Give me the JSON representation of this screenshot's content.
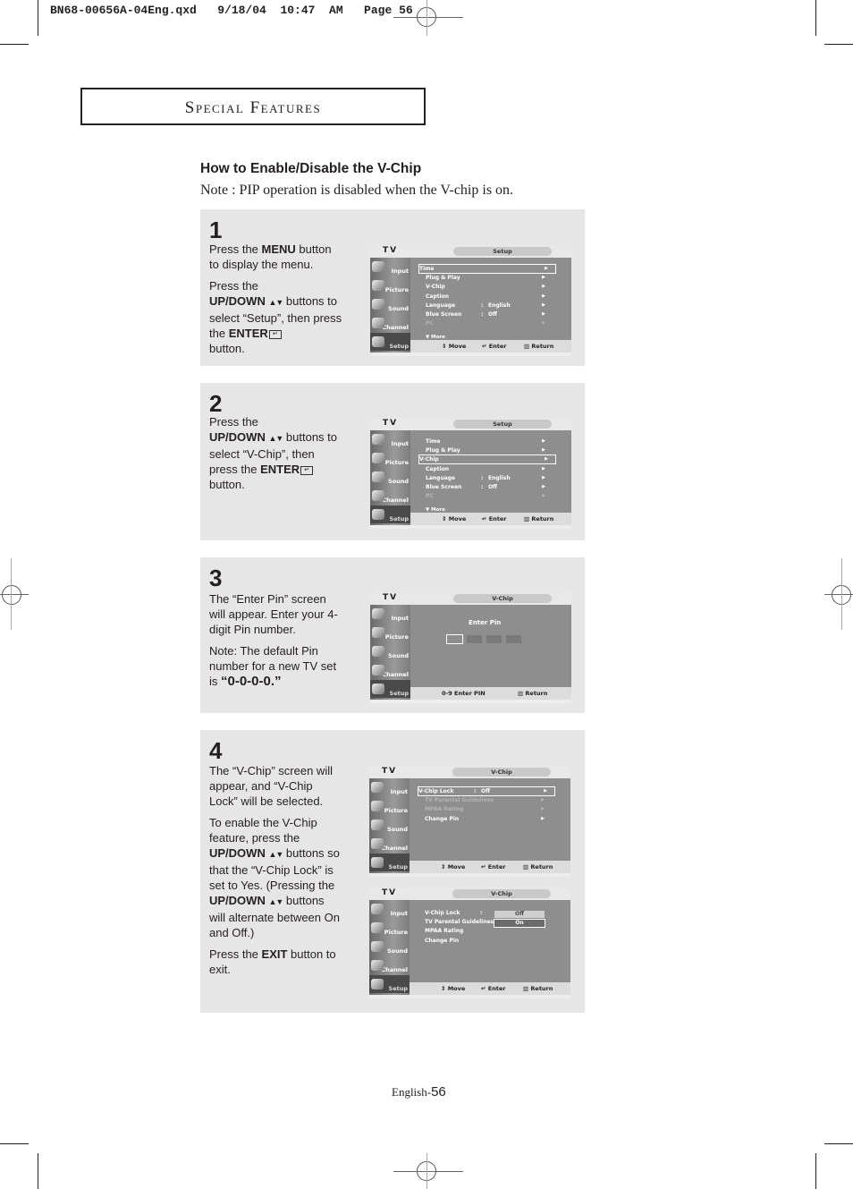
{
  "print_slug": "BN68-00656A-04Eng.qxd   9/18/04  10:47  AM   Page 56",
  "section_title": "Special Features",
  "heading": "How to Enable/Disable the V-Chip",
  "note": "Note : PIP operation is disabled when the V-chip is on.",
  "osd_common": {
    "tv_label": "TV",
    "sidebar": [
      "Input",
      "Picture",
      "Sound",
      "Channel",
      "Setup"
    ],
    "bottom": {
      "move": "Move",
      "enter": "Enter",
      "return": "Return"
    },
    "arrow": "▶",
    "updown_glyph": "▲▼"
  },
  "steps": [
    {
      "number": "1",
      "p1_a": "Press the ",
      "p1_b": "MENU",
      "p1_c": " button to display the menu.",
      "p2_a": "Press the ",
      "p2_b": "UP/DOWN",
      "p2_c": " buttons to select “Setup”, then press the ",
      "p2_d": "ENTER",
      "p2_e": " button.",
      "osd": {
        "title": "Setup",
        "rows": [
          {
            "label": "Time",
            "state": "selected"
          },
          {
            "label": "Plug & Play"
          },
          {
            "label": "V-Chip"
          },
          {
            "label": "Caption"
          },
          {
            "label": "Language",
            "value": "English"
          },
          {
            "label": "Blue Screen",
            "value": "Off"
          },
          {
            "label": "PC",
            "state": "dim"
          }
        ],
        "more": "▼ More"
      }
    },
    {
      "number": "2",
      "p1_a": "Press the ",
      "p1_b": "UP/DOWN",
      "p1_c": " buttons to select “V-Chip”, then press the ",
      "p1_d": "ENTER",
      "p1_e": " button.",
      "osd": {
        "title": "Setup",
        "rows": [
          {
            "label": "Time"
          },
          {
            "label": "Plug & Play"
          },
          {
            "label": "V-Chip",
            "state": "selected"
          },
          {
            "label": "Caption"
          },
          {
            "label": "Language",
            "value": "English"
          },
          {
            "label": "Blue Screen",
            "value": "Off"
          },
          {
            "label": "PC",
            "state": "dim"
          }
        ],
        "more": "▼ More"
      }
    },
    {
      "number": "3",
      "p1": "The “Enter Pin” screen will appear. Enter your 4-digit Pin number.",
      "p2_a": "Note: The default Pin number for a new TV set is ",
      "p2_b": "“0-0-0-0.”",
      "osd": {
        "title": "V-Chip",
        "prompt": "Enter Pin",
        "pin_digits": 4,
        "bottom_hint": "0-9 Enter PIN",
        "return": "Return"
      }
    },
    {
      "number": "4",
      "p1": "The “V-Chip” screen will appear, and “V-Chip Lock” will be selected.",
      "p2_a": "To enable the V-Chip feature, press the ",
      "p2_b": "UP/DOWN",
      "p2_c": " buttons so that the “V-Chip Lock” is set to Yes. (Pressing the ",
      "p2_d": "UP/DOWN",
      "p2_e": " buttons will alternate between On and Off.)",
      "p3_a": "Press the ",
      "p3_b": "EXIT",
      "p3_c": " button to exit.",
      "osd_a": {
        "title": "V-Chip",
        "rows": [
          {
            "label": "V-Chip Lock",
            "value": "Off",
            "state": "selected"
          },
          {
            "label": "TV Parental Guidelines",
            "state": "dim"
          },
          {
            "label": "MPAA Rating",
            "state": "dim"
          },
          {
            "label": "Change Pin"
          }
        ]
      },
      "osd_b": {
        "title": "V-Chip",
        "rows": [
          {
            "label": "V-Chip Lock"
          },
          {
            "label": "TV Parental Guidelines"
          },
          {
            "label": "MPAA Rating"
          },
          {
            "label": "Change Pin"
          }
        ],
        "options": [
          "Off",
          "On"
        ],
        "selected_option": "On"
      }
    }
  ],
  "footer": {
    "prefix": "English-",
    "page": "56"
  }
}
